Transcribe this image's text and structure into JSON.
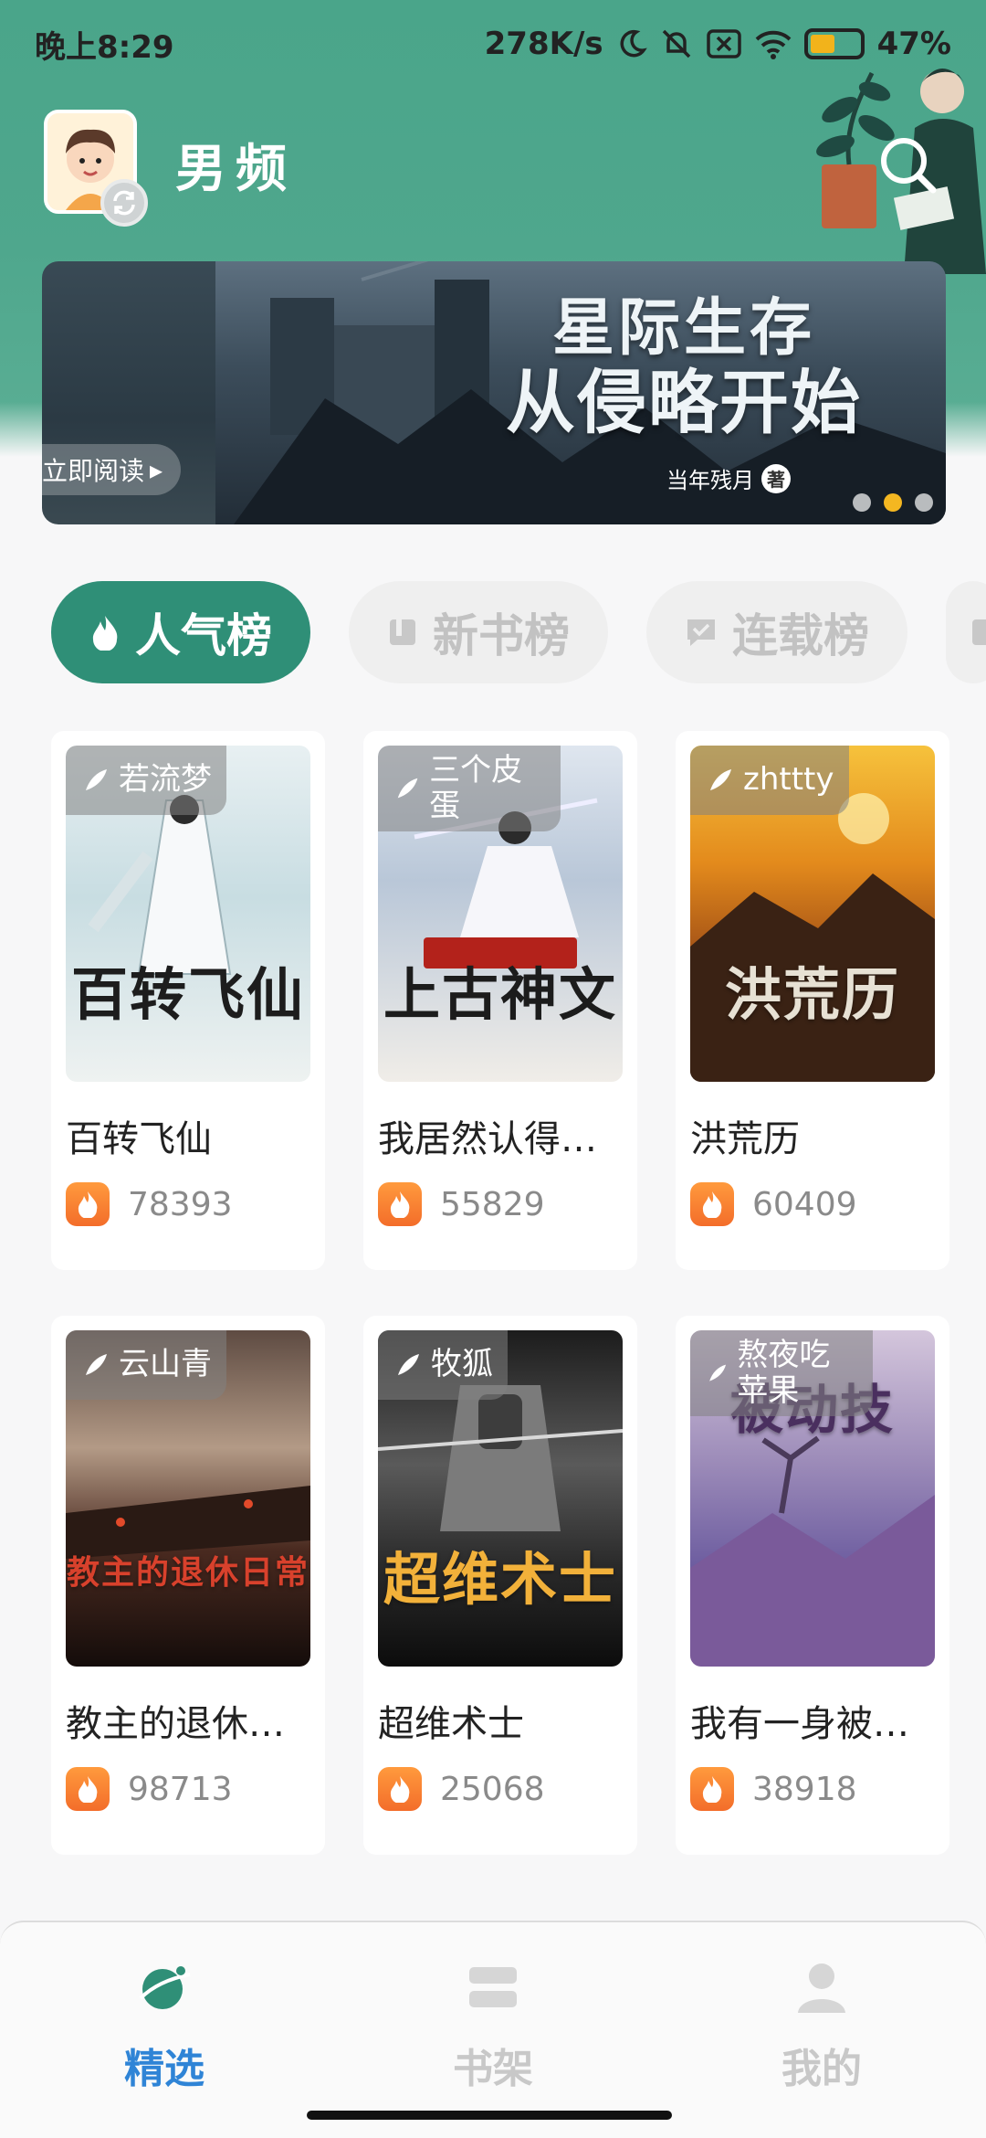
{
  "status_bar": {
    "time": "晚上8:29",
    "network_speed": "278K/s",
    "battery": "47%",
    "battery_level": 0.47
  },
  "header": {
    "channel": "男频",
    "avatar_icon": "avatar-icon",
    "switch_icon": "refresh-icon",
    "search_icon": "search-icon"
  },
  "banner": {
    "peek_button": "立即阅读",
    "title_line1": "星际生存",
    "title_line2": "从侵略开始",
    "author": "当年残月",
    "author_suffix": "著",
    "page_count": 3,
    "active_page": 2
  },
  "tabs": [
    {
      "label": "人气榜",
      "icon": "fire-icon",
      "active": true
    },
    {
      "label": "新书榜",
      "icon": "book-icon",
      "active": false
    },
    {
      "label": "连载榜",
      "icon": "chat-check-icon",
      "active": false
    }
  ],
  "books": [
    {
      "author": "若流梦",
      "cover_text": "百转飞仙",
      "title": "百转飞仙",
      "heat": "78393"
    },
    {
      "author": "三个皮蛋",
      "cover_text": "上古神文",
      "title": "我居然认得…",
      "heat": "55829"
    },
    {
      "author": "zhttty",
      "cover_text": "洪荒历",
      "title": "洪荒历",
      "heat": "60409"
    },
    {
      "author": "云山青",
      "cover_text": "教主的退休日常",
      "title": "教主的退休…",
      "heat": "98713"
    },
    {
      "author": "牧狐",
      "cover_text": "超维术士",
      "title": "超维术士",
      "heat": "25068"
    },
    {
      "author": "熬夜吃苹果",
      "cover_text": "被动技",
      "title": "我有一身被…",
      "heat": "38918"
    }
  ],
  "bottom_nav": [
    {
      "label": "精选",
      "icon": "planet-icon",
      "active": true
    },
    {
      "label": "书架",
      "icon": "bookshelf-icon",
      "active": false
    },
    {
      "label": "我的",
      "icon": "user-icon",
      "active": false
    }
  ],
  "colors": {
    "theme_green": "#2f8f77",
    "accent_blue": "#2f84d6",
    "heat_orange": "#f36d2a"
  }
}
